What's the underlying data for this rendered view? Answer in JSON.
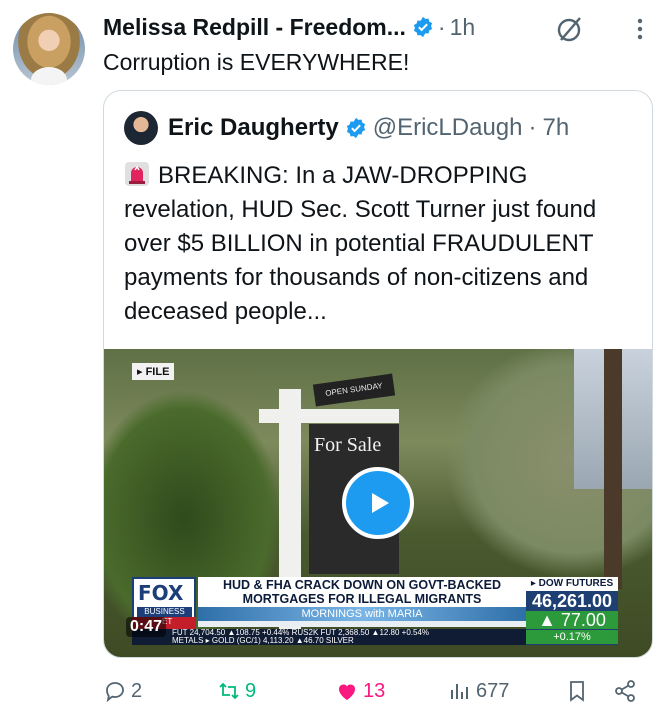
{
  "post": {
    "author_name": "Melissa Redpill - Freedom...",
    "separator": "·",
    "time": "1h",
    "text": "Corruption is EVERYWHERE!"
  },
  "quote": {
    "author_name": "Eric Daugherty",
    "handle": "@EricLDaugh",
    "separator": "·",
    "time": "7h",
    "text": "BREAKING: In a JAW-DROPPING revelation, HUD Sec. Scott Turner just found over $5 BILLION in potential FRAUDULENT payments for thousands of non-citizens and deceased people..."
  },
  "media": {
    "file_tag": "▸ FILE",
    "sign_top": "OPEN SUNDAY",
    "sign_text": "For Sale",
    "duration": "0:47",
    "network_logo": "FOX",
    "network_sub": "BUSINESS",
    "live_tag": "ET",
    "headline_line1": "HUD & FHA CRACK DOWN ON GOVT-BACKED",
    "headline_line2": "MORTGAGES FOR ILLEGAL MIGRANTS",
    "show_name": "MORNINGS with MARIA",
    "dow_label": "▸ DOW FUTURES",
    "dow_value": "46,261.00",
    "dow_change": "▲ 77.00",
    "dow_pct": "+0.17%",
    "index_line1": "FUT  24,704.50 ▲108.75 +0.44%  RUS2K FUT  2,368.50 ▲12.80 +0.54%",
    "index_line2": "METALS  ▸  GOLD (GC/1)  4,113.20 ▲46.70  SILVER"
  },
  "actions": {
    "replies": "2",
    "reposts": "9",
    "likes": "13",
    "views": "677"
  },
  "colors": {
    "verified": "#1d9bf0",
    "repost": "#00ba7c",
    "like": "#f91880",
    "muted": "#536471"
  },
  "icons": [
    "verified-badge-icon",
    "grok-icon",
    "more-icon",
    "siren-icon",
    "play-icon",
    "reply-icon",
    "repost-icon",
    "heart-icon",
    "views-icon",
    "bookmark-icon",
    "share-icon"
  ]
}
